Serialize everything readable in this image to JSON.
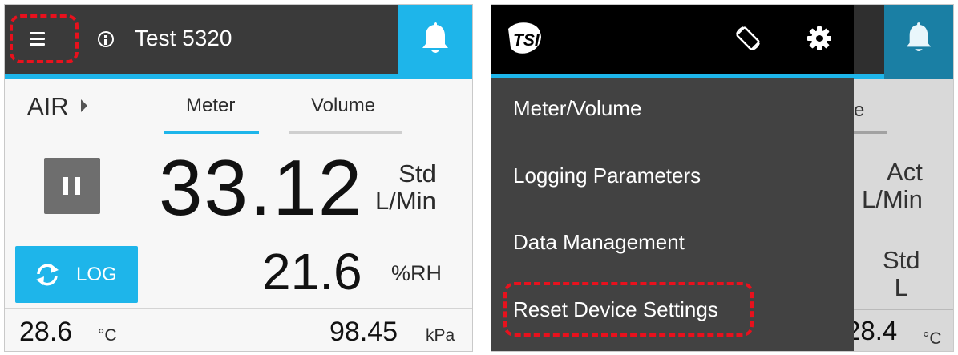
{
  "left": {
    "title": "Test 5320",
    "tabs": {
      "air": "AIR",
      "meter": "Meter",
      "volume": "Volume"
    },
    "main_value": "33.12",
    "main_units": {
      "line1": "Std",
      "line2": "L/Min"
    },
    "log_button": "LOG",
    "humidity_value": "21.6",
    "humidity_unit": "%RH",
    "temperature_value": "28.6",
    "temperature_unit": "°C",
    "pressure_value": "98.45",
    "pressure_unit": "kPa"
  },
  "right": {
    "menu_items": [
      "Meter/Volume",
      "Logging Parameters",
      "Data Management",
      "Reset Device Settings"
    ],
    "behind": {
      "tab_fragment": "e",
      "units1": {
        "line1": "Act",
        "line2": "L/Min"
      },
      "units2": {
        "line1": "Std",
        "line2": "L"
      },
      "temp_fragment": "28.4",
      "temp_unit": "°C"
    }
  },
  "colors": {
    "accent": "#1eb5ea",
    "highlight": "#e8111d",
    "topbar": "#3a3a3a",
    "drawer": "#424242"
  },
  "icons": [
    "menu-icon",
    "info-icon",
    "bell-icon",
    "pause-icon",
    "refresh-icon",
    "tsi-logo",
    "screen-rotate-icon",
    "gear-icon"
  ]
}
